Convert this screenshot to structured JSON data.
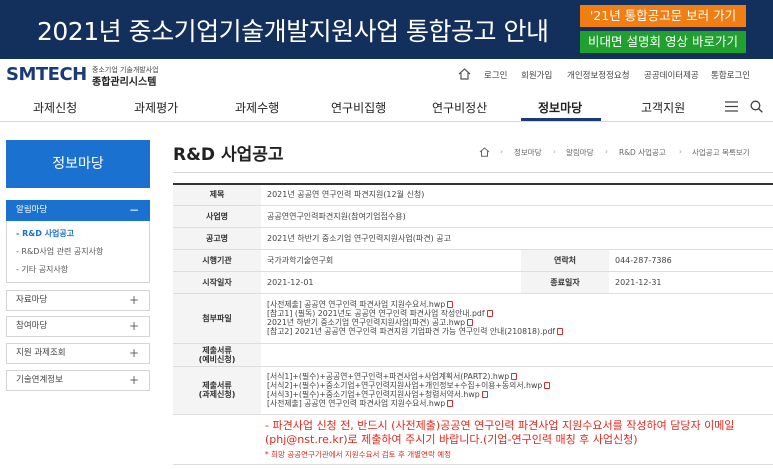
{
  "banner": {
    "title": "2021년 중소기업기술개발지원사업 통합공고 안내",
    "btn_announcement": "'21년 통합공고문 보러 가기",
    "btn_video": "비대면 설명회 영상 바로가기"
  },
  "header": {
    "logo": "SMTECH",
    "logo_sub1": "중소기업 기술개발사업",
    "logo_sub2": "종합관리시스템",
    "util": [
      "로그인",
      "회원가입",
      "개인정보정정요청",
      "공공데이터제공",
      "통합로그인"
    ]
  },
  "gnb": [
    "과제신청",
    "과제평가",
    "과제수행",
    "연구비집행",
    "연구비정산",
    "정보마당",
    "고객지원"
  ],
  "sidebar": {
    "title": "정보마당",
    "groups": [
      {
        "label": "알림마당",
        "icon": "−"
      },
      {
        "label": "자료마당",
        "icon": "+"
      },
      {
        "label": "참여마당",
        "icon": "+"
      },
      {
        "label": "지원 과제조회",
        "icon": "+"
      },
      {
        "label": "기술연계정보",
        "icon": "+"
      }
    ],
    "subitems": [
      "- R&D 사업공고",
      "- R&D사업 관련 공지사항",
      "- 기타 공지사항"
    ]
  },
  "page": {
    "title": "R&D 사업공고",
    "breadcrumb": [
      "정보마당",
      "알림마당",
      "R&D 사업공고",
      "사업공고 목록보기"
    ]
  },
  "detail": {
    "labels": {
      "title": "제목",
      "business": "사업명",
      "notice": "공고명",
      "agency": "시행기관",
      "contact": "연락처",
      "start": "시작일자",
      "end": "종료일자",
      "attach": "첨부파일",
      "submit_prelim1": "제출서류",
      "submit_prelim2": "(예비신청)",
      "submit_task1": "제출서류",
      "submit_task2": "(과제신청)"
    },
    "title": "2021년 공공연 연구인력 파견지원(12월 신청)",
    "business": "공공연연구인력파견지원(참여기업접수용)",
    "notice": "2021년 하반기 중소기업 연구인력지원사업(파견) 공고",
    "agency": "국가과학기술연구회",
    "contact": "044-287-7386",
    "start": "2021-12-01",
    "end": "2021-12-31",
    "attachments": [
      "[사전제출] 공공연 연구인력 파견사업 지원수요서.hwp",
      "[참고1] (필독) 2021년도 공공연 연구인력 파견사업 작성안내.pdf",
      "2021년 하반기 중소기업 연구인력지원사업(파견) 공고.hwp",
      "[참고2] 2021년 공공연 연구인력 파견지원 기업파견 가능 연구인력 안내(210818).pdf"
    ],
    "task_files": [
      "[서식1]+(필수)+공공연+연구인력+파견사업+사업계획서(PART2).hwp",
      "[서식2]+(필수)+중소기업+연구인력지원사업+개인정보+수집+이용+동의서.hwp",
      "[서식3]+(필수)+중소기업+연구인력지원사업+청렴서약서.hwp",
      "[사전제출] 공공연 연구인력 파견사업 지원수요서.hwp"
    ],
    "notice_main": "- 파견사업 신청 전, 반드시 (사전제출)공공연 연구인력 파견사업 지원수요서를 작성하여 담당자 이메일(phj@nst.re.kr)로 제출하여 주시기 바랍니다.(기업-연구인력 매칭 후 사업신청)",
    "notice_sub": "* 희망 공공연구기관에서 지원수요서 검토 후 개별연락 예정"
  }
}
